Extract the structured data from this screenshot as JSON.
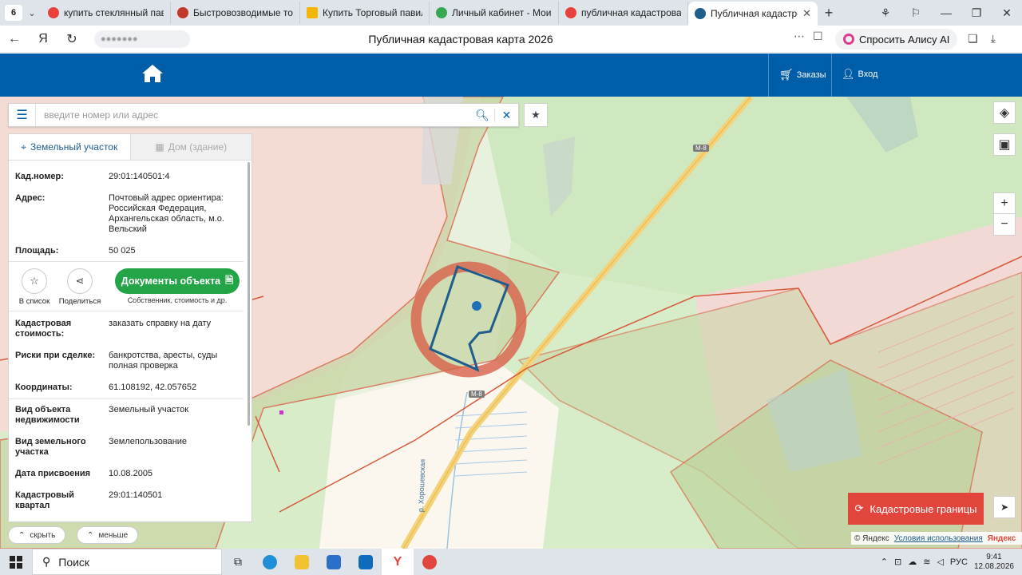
{
  "browser": {
    "tab_count": "6",
    "tabs": [
      {
        "title": "купить стеклянный пави",
        "favicon_color": "#e8413b"
      },
      {
        "title": "Быстровозводимые тор",
        "favicon_color": "#c0392b"
      },
      {
        "title": "Купить Торговый павиль",
        "favicon_color": "#f2b705"
      },
      {
        "title": "Личный кабинет - Мои о",
        "favicon_color": "#34a853"
      },
      {
        "title": "публичная кадастровая",
        "favicon_color": "#e8413b"
      },
      {
        "title": "Публичная кадастров",
        "favicon_color": "#1f5d8c"
      }
    ],
    "page_title": "Публичная кадастровая карта 2026",
    "alice_label": "Спросить Алису AI"
  },
  "header": {
    "orders_label": "Заказы",
    "login_label": "Вход",
    "bg_color": "#005ea8"
  },
  "search": {
    "placeholder": "введите номер или адрес"
  },
  "panel": {
    "tab_land": "Земельный участок",
    "tab_building": "Дом (здание)",
    "rows": {
      "cad_number_label": "Кад.номер:",
      "cad_number_value": "29:01:140501:4",
      "address_label": "Адрес:",
      "address_value": "Почтовый адрес ориентира: Российская Федерация, Архангельская область, м.о. Вельский",
      "area_label": "Площадь:",
      "area_value": "50 025",
      "cost_label": "Кадастровая стоимость:",
      "cost_value": "заказать справку на дату",
      "risks_label": "Риски при сделке:",
      "risks_value": "банкротства, аресты, суды",
      "risks_link": "полная проверка",
      "coords_label": "Координаты:",
      "coords_value": "61.108192, 42.057652",
      "object_type_label": "Вид объекта недвижимости",
      "object_type_value": "Земельный участок",
      "land_type_label": "Вид земельного участка",
      "land_type_value": "Землепользование",
      "date_label": "Дата присвоения",
      "date_value": "10.08.2005",
      "quarter_label": "Кадастровый квартал",
      "quarter_value": "29:01:140501"
    },
    "actions": {
      "favorite_label": "В список",
      "share_label": "Поделиться",
      "documents_label": "Документы объекта",
      "documents_sub": "Собственник, стоимость и др."
    }
  },
  "map": {
    "road_label_1": "М-8",
    "road_label_2": "М-8",
    "river_label": "р. Хорошевская",
    "hide_label": "скрыть",
    "less_label": "меньше",
    "cadastral_btn": "Кадастровые границы",
    "copyright": "© Яндекс",
    "terms": "Условия использования",
    "yandex": "Яндекс",
    "accent": "#e2453c"
  },
  "taskbar": {
    "search_label": "Поиск",
    "lang": "РУС",
    "time": "9:41",
    "date": "12.08.2026"
  }
}
